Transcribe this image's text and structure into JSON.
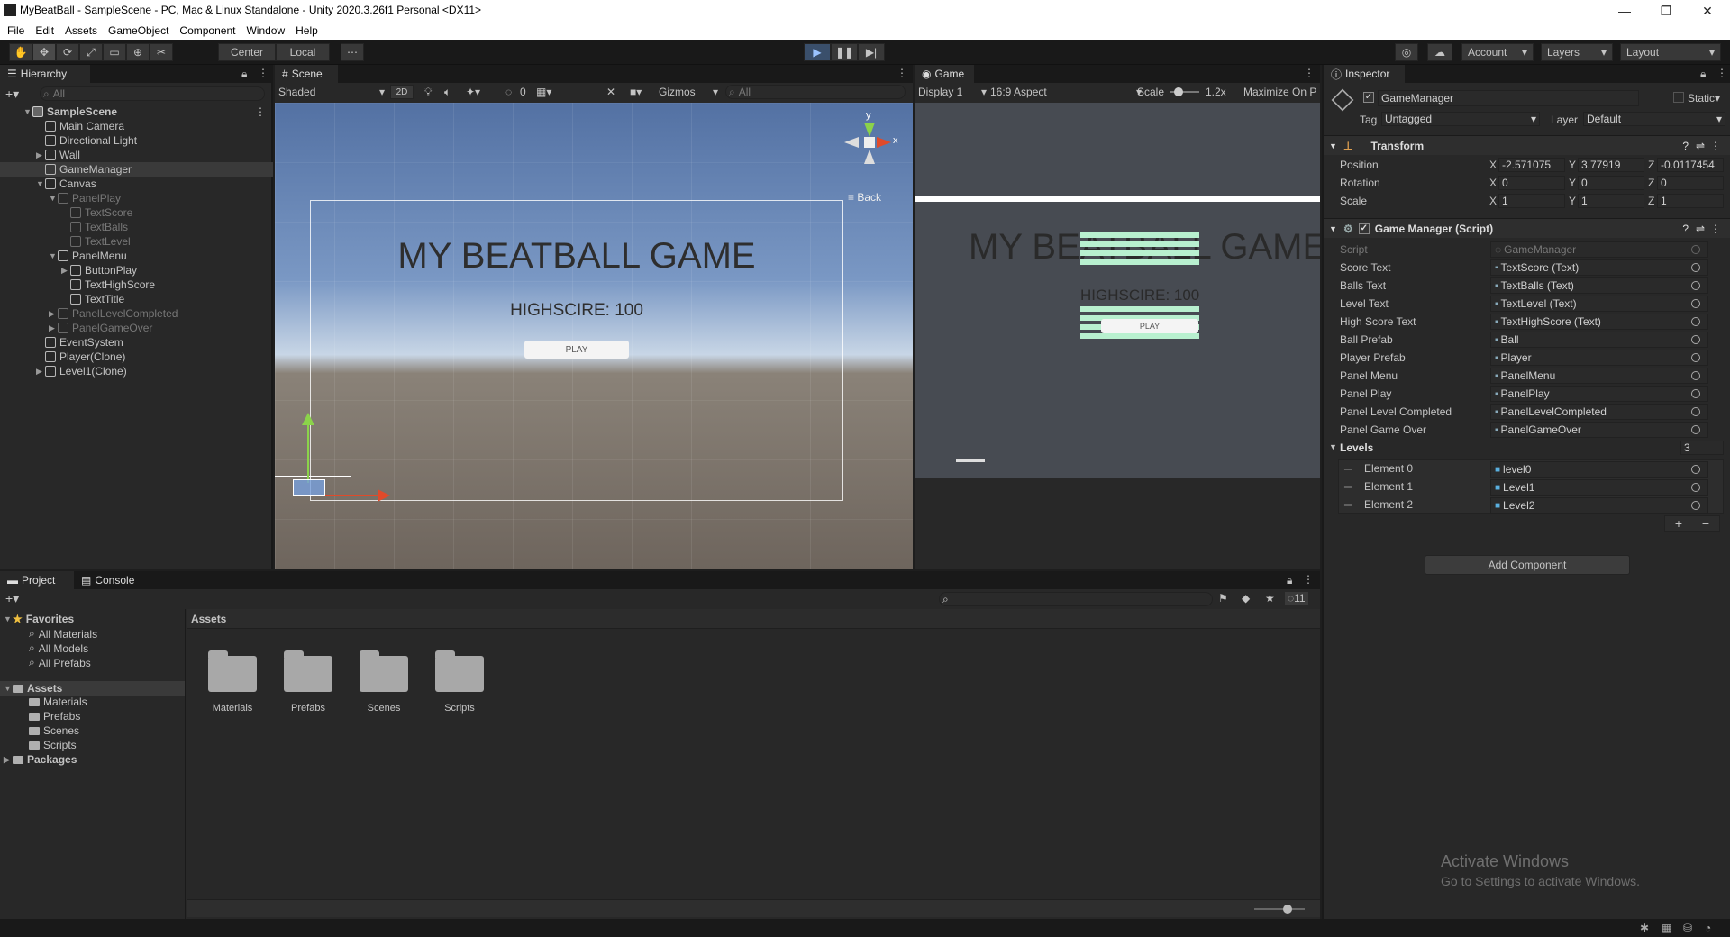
{
  "window": {
    "title": "MyBeatBall - SampleScene - PC, Mac & Linux Standalone - Unity 2020.3.26f1 Personal <DX11>"
  },
  "menu": [
    "File",
    "Edit",
    "Assets",
    "GameObject",
    "Component",
    "Window",
    "Help"
  ],
  "toolbar": {
    "pivot": "Center",
    "space": "Local",
    "account": "Account",
    "layers": "Layers",
    "layout": "Layout"
  },
  "hierarchy": {
    "tab": "Hierarchy",
    "search_placeholder": "All",
    "items": [
      {
        "label": "SampleScene",
        "depth": 0,
        "scene": true,
        "sel": false,
        "dim": false,
        "arrow": "▼"
      },
      {
        "label": "Main Camera",
        "depth": 1,
        "sel": false,
        "dim": false,
        "arrow": ""
      },
      {
        "label": "Directional Light",
        "depth": 1,
        "sel": false,
        "dim": false,
        "arrow": ""
      },
      {
        "label": "Wall",
        "depth": 1,
        "sel": false,
        "dim": false,
        "arrow": "▶"
      },
      {
        "label": "GameManager",
        "depth": 1,
        "sel": true,
        "dim": false,
        "arrow": ""
      },
      {
        "label": "Canvas",
        "depth": 1,
        "sel": false,
        "dim": false,
        "arrow": "▼"
      },
      {
        "label": "PanelPlay",
        "depth": 2,
        "sel": false,
        "dim": true,
        "arrow": "▼"
      },
      {
        "label": "TextScore",
        "depth": 3,
        "sel": false,
        "dim": true,
        "arrow": ""
      },
      {
        "label": "TextBalls",
        "depth": 3,
        "sel": false,
        "dim": true,
        "arrow": ""
      },
      {
        "label": "TextLevel",
        "depth": 3,
        "sel": false,
        "dim": true,
        "arrow": ""
      },
      {
        "label": "PanelMenu",
        "depth": 2,
        "sel": false,
        "dim": false,
        "arrow": "▼"
      },
      {
        "label": "ButtonPlay",
        "depth": 3,
        "sel": false,
        "dim": false,
        "arrow": "▶"
      },
      {
        "label": "TextHighScore",
        "depth": 3,
        "sel": false,
        "dim": false,
        "arrow": ""
      },
      {
        "label": "TextTitle",
        "depth": 3,
        "sel": false,
        "dim": false,
        "arrow": ""
      },
      {
        "label": "PanelLevelCompleted",
        "depth": 2,
        "sel": false,
        "dim": true,
        "arrow": "▶"
      },
      {
        "label": "PanelGameOver",
        "depth": 2,
        "sel": false,
        "dim": true,
        "arrow": "▶"
      },
      {
        "label": "EventSystem",
        "depth": 1,
        "sel": false,
        "dim": false,
        "arrow": ""
      },
      {
        "label": "Player(Clone)",
        "depth": 1,
        "sel": false,
        "dim": false,
        "arrow": ""
      },
      {
        "label": "Level1(Clone)",
        "depth": 1,
        "sel": false,
        "dim": false,
        "arrow": "▶"
      }
    ]
  },
  "scene": {
    "tab": "Scene",
    "shading": "Shaded",
    "mode_2d": "2D",
    "hidden_count": "0",
    "gizmos": "Gizmos",
    "search_placeholder": "All",
    "gizmo_y": "y",
    "gizmo_x": "x",
    "back": "Back",
    "title": "MY BEATBALL GAME",
    "highscore": "HIGHSCIRE: 100",
    "play": "PLAY"
  },
  "game": {
    "tab": "Game",
    "display": "Display 1",
    "aspect": "16:9 Aspect",
    "scale_label": "Scale",
    "scale_value": "1.2x",
    "maximize": "Maximize On P",
    "title": "MY BEATBALL GAME",
    "highscore": "HIGHSCIRE: 100",
    "play": "PLAY"
  },
  "inspector": {
    "tab": "Inspector",
    "object_name": "GameManager",
    "static": "Static",
    "tag_label": "Tag",
    "tag_value": "Untagged",
    "layer_label": "Layer",
    "layer_value": "Default",
    "transform": {
      "title": "Transform",
      "position_label": "Position",
      "rotation_label": "Rotation",
      "scale_label": "Scale",
      "position": [
        "-2.571075",
        "3.77919",
        "-0.0117454"
      ],
      "rotation": [
        "0",
        "0",
        "0"
      ],
      "scale": [
        "1",
        "1",
        "1"
      ],
      "axis": [
        "X",
        "Y",
        "Z"
      ]
    },
    "script_component": {
      "title": "Game Manager (Script)",
      "script_label": "Script",
      "script_value": "GameManager",
      "fields": [
        {
          "label": "Score Text",
          "value": "TextScore (Text)"
        },
        {
          "label": "Balls Text",
          "value": "TextBalls (Text)"
        },
        {
          "label": "Level Text",
          "value": "TextLevel (Text)"
        },
        {
          "label": "High Score Text",
          "value": "TextHighScore (Text)"
        },
        {
          "label": "Ball Prefab",
          "value": "Ball"
        },
        {
          "label": "Player Prefab",
          "value": "Player"
        },
        {
          "label": "Panel Menu",
          "value": "PanelMenu"
        },
        {
          "label": "Panel Play",
          "value": "PanelPlay"
        },
        {
          "label": "Panel Level Completed",
          "value": "PanelLevelCompleted"
        },
        {
          "label": "Panel Game Over",
          "value": "PanelGameOver"
        }
      ],
      "levels_label": "Levels",
      "levels_count": "3",
      "levels": [
        {
          "label": "Element 0",
          "value": "level0"
        },
        {
          "label": "Element 1",
          "value": "Level1"
        },
        {
          "label": "Element 2",
          "value": "Level2"
        }
      ]
    },
    "add_component": "Add Component",
    "watermark_title": "Activate Windows",
    "watermark_sub": "Go to Settings to activate Windows."
  },
  "project": {
    "tab_project": "Project",
    "tab_console": "Console",
    "hidden_count": "11",
    "favorites_label": "Favorites",
    "favorites": [
      "All Materials",
      "All Models",
      "All Prefabs"
    ],
    "assets_label": "Assets",
    "asset_folders": [
      "Materials",
      "Prefabs",
      "Scenes",
      "Scripts"
    ],
    "packages_label": "Packages",
    "breadcrumb": "Assets",
    "grid": [
      "Materials",
      "Prefabs",
      "Scenes",
      "Scripts"
    ]
  }
}
